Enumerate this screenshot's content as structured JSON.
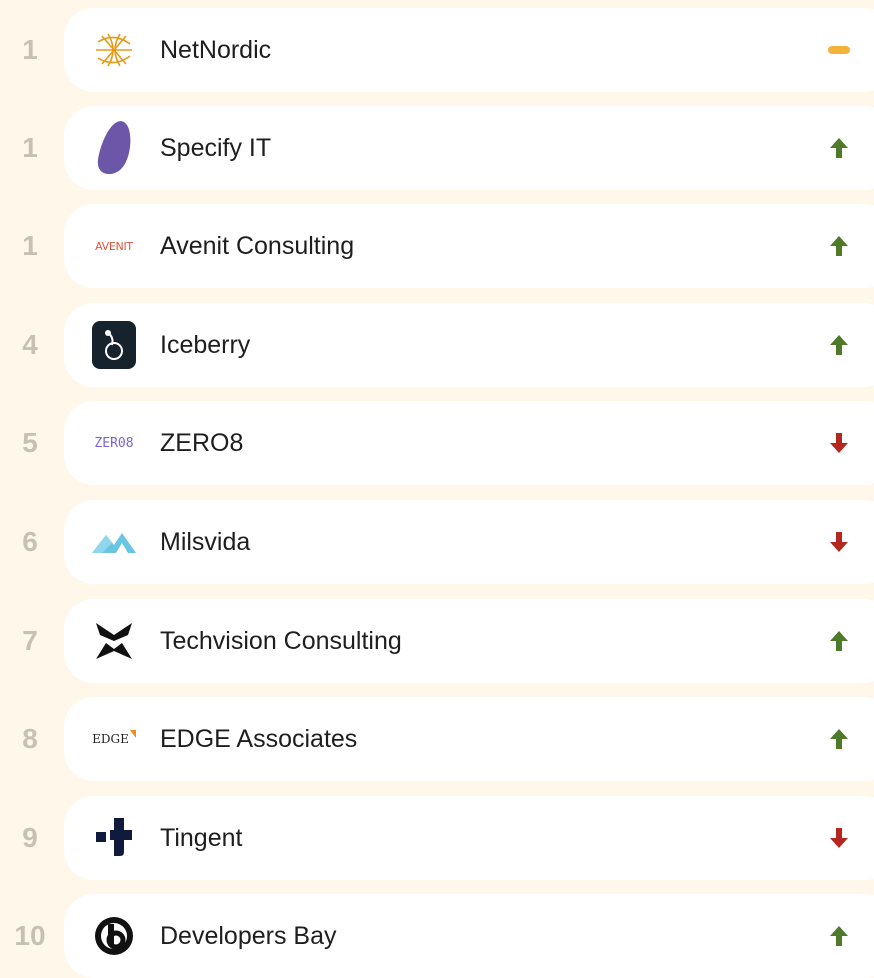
{
  "colors": {
    "background": "#fff7ea",
    "card": "#ffffff",
    "rank": "#c9c0b4",
    "up": "#4f7a2a",
    "down": "#b5261e",
    "same": "#f4b23a"
  },
  "ranking": {
    "rows": [
      {
        "rank": "1",
        "name": "NetNordic",
        "logo": "netnordic-logo",
        "trend": "same"
      },
      {
        "rank": "1",
        "name": "Specify IT",
        "logo": "specify-it-logo",
        "trend": "up"
      },
      {
        "rank": "1",
        "name": "Avenit Consulting",
        "logo": "avenit-logo",
        "logo_text": "AVENIT",
        "trend": "up"
      },
      {
        "rank": "4",
        "name": "Iceberry",
        "logo": "iceberry-logo",
        "trend": "up"
      },
      {
        "rank": "5",
        "name": "ZERO8",
        "logo": "zero8-logo",
        "logo_text": "ZER08",
        "trend": "down"
      },
      {
        "rank": "6",
        "name": "Milsvida",
        "logo": "milsvida-logo",
        "trend": "down"
      },
      {
        "rank": "7",
        "name": "Techvision Consulting",
        "logo": "techvision-logo",
        "trend": "up"
      },
      {
        "rank": "8",
        "name": "EDGE Associates",
        "logo": "edge-logo",
        "logo_text": "EDGE",
        "trend": "up"
      },
      {
        "rank": "9",
        "name": "Tingent",
        "logo": "tingent-logo",
        "trend": "down"
      },
      {
        "rank": "10",
        "name": "Developers Bay",
        "logo": "developers-bay-logo",
        "trend": "up"
      }
    ]
  }
}
